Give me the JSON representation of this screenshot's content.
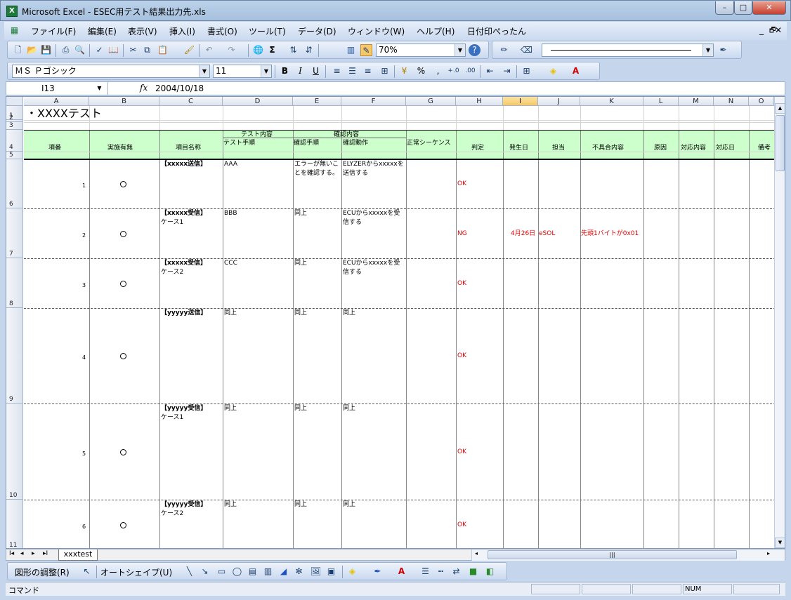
{
  "window": {
    "title": "Microsoft Excel - ESEC用テスト結果出力先.xls",
    "minimize": "–",
    "maximize": "□",
    "close": "✕"
  },
  "menu": {
    "items": [
      "ファイル(F)",
      "編集(E)",
      "表示(V)",
      "挿入(I)",
      "書式(O)",
      "ツール(T)",
      "データ(D)",
      "ウィンドウ(W)",
      "ヘルプ(H)",
      "日付印ぺったん"
    ],
    "mdi_min": "_",
    "mdi_restore": "🗗",
    "mdi_close": "✕"
  },
  "toolbar": {
    "zoom": "70%",
    "font": "ＭＳ Ｐゴシック",
    "size": "11",
    "percent": "%",
    "comma": ",",
    "sigma": "Σ"
  },
  "formula": {
    "cell": "I13",
    "fx": "fx",
    "value": "2004/10/18"
  },
  "columns": [
    "A",
    "B",
    "C",
    "D",
    "E",
    "F",
    "G",
    "H",
    "I",
    "J",
    "K",
    "L",
    "M",
    "N",
    "O"
  ],
  "rows": [
    "1",
    "2",
    "3",
    "4",
    "5",
    "6",
    "7",
    "8",
    "9",
    "10",
    "11"
  ],
  "sheet": {
    "title": "・XXXXテスト",
    "headers": {
      "no": "項番",
      "exec": "実施有無",
      "item": "項目名称",
      "group1": "テスト内容",
      "group2": "確認内容",
      "test_proc": "テスト手順",
      "check_proc": "確認手順",
      "check_action": "確認動作",
      "normal_seq": "正常シーケンス",
      "judge": "判定",
      "date": "発生日",
      "owner": "担当",
      "defect": "不具合内容",
      "cause": "原因",
      "action": "対応内容",
      "action_date": "対応日",
      "note": "備考"
    },
    "records": [
      {
        "no": "1",
        "mark": "○",
        "item1": "【xxxxx送信】",
        "item2": "",
        "test": "AAA",
        "check1": "エラーが無いこ",
        "check2": "とを確認する。",
        "act1": "ELYZERからxxxxxを",
        "act2": "送信する",
        "judge": "OK",
        "date": "",
        "owner": "",
        "defect": ""
      },
      {
        "no": "2",
        "mark": "○",
        "item1": "【xxxxx受信】",
        "item2": "ケース1",
        "test": "BBB",
        "check1": "同上",
        "check2": "",
        "act1": "ECUからxxxxxを受",
        "act2": "信する",
        "judge": "NG",
        "date": "4月26日",
        "owner": "eSOL",
        "defect": "先頭1バイトが0x01"
      },
      {
        "no": "3",
        "mark": "○",
        "item1": "【xxxxx受信】",
        "item2": "ケース2",
        "test": "CCC",
        "check1": "同上",
        "check2": "",
        "act1": "ECUからxxxxxを受",
        "act2": "信する",
        "judge": "OK",
        "date": "",
        "owner": "",
        "defect": ""
      },
      {
        "no": "4",
        "mark": "○",
        "item1": "【yyyyy送信】",
        "item2": "",
        "test": "同上",
        "check1": "同上",
        "check2": "",
        "act1": "同上",
        "act2": "",
        "judge": "OK",
        "date": "",
        "owner": "",
        "defect": ""
      },
      {
        "no": "5",
        "mark": "○",
        "item1": "【yyyyy受信】",
        "item2": "ケース1",
        "test": "同上",
        "check1": "同上",
        "check2": "",
        "act1": "同上",
        "act2": "",
        "judge": "OK",
        "date": "",
        "owner": "",
        "defect": ""
      },
      {
        "no": "6",
        "mark": "○",
        "item1": "【yyyyy受信】",
        "item2": "ケース2",
        "test": "同上",
        "check1": "同上",
        "check2": "",
        "act1": "同上",
        "act2": "",
        "judge": "OK",
        "date": "",
        "owner": "",
        "defect": ""
      }
    ]
  },
  "tabs": {
    "sheet": "xxxtest",
    "nav": [
      "I◂",
      "◂",
      "▸",
      "▸I"
    ]
  },
  "drawbar": {
    "adjust": "図形の調整(R)",
    "autoshape": "オートシェイプ(U)"
  },
  "status": {
    "mode": "コマンド",
    "num": "NUM"
  }
}
